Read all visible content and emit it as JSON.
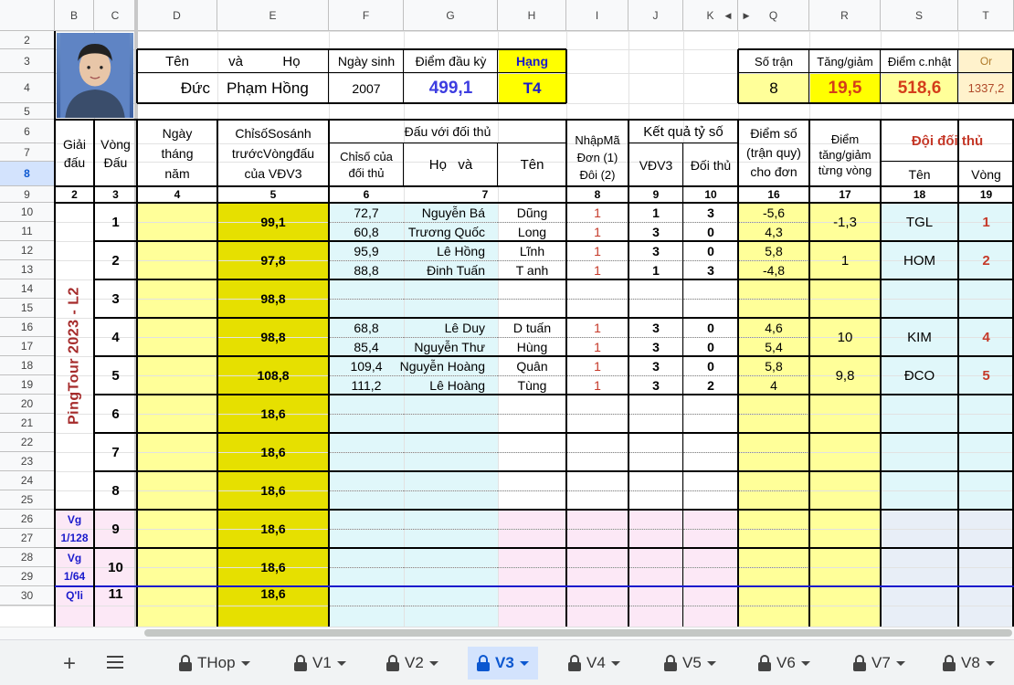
{
  "columns": [
    "B",
    "C",
    "D",
    "E",
    "F",
    "G",
    "H",
    "I",
    "J",
    "K",
    "Q",
    "R",
    "S",
    "T"
  ],
  "rows": [
    "2",
    "3",
    "4",
    "5",
    "6",
    "7",
    "8",
    "9",
    "10",
    "11",
    "12",
    "13",
    "14",
    "15",
    "16",
    "17",
    "18",
    "19",
    "20",
    "21",
    "22",
    "23",
    "24",
    "25",
    "26",
    "27",
    "28",
    "29",
    "30"
  ],
  "selected_row": "8",
  "player": {
    "name_header": {
      "ten": "Tên",
      "va": "và",
      "ho": "Họ"
    },
    "first_name": "Đức",
    "last_name": "Phạm Hồng",
    "dob_label": "Ngày sinh",
    "dob": "2007",
    "start_points_label": "Điểm đầu kỳ",
    "start_points": "499,1",
    "rank_label": "Hạng",
    "rank": "T4"
  },
  "summary": {
    "matches_label": "Số trận",
    "matches": "8",
    "change_label": "Tăng/giảm",
    "change": "19,5",
    "updated_label": "Điểm c.nhật",
    "updated": "518,6",
    "or_label": "Or",
    "or_value": "1337,2"
  },
  "headers": {
    "giai": "Giải đấu",
    "vong_dau": "Vòng Đấu",
    "ngay": "Ngày tháng năm",
    "chiso": "ChỉsốSosánh trướcVòngđấu của VĐV3",
    "dau_voi": "Đấu với đối thủ",
    "chiso_doithu": "Chỉsố của đối thủ",
    "ho_va": "Họ   và",
    "ten": "Tên",
    "nhapma": "NhậpMã Đơn (1) Đôi (2)",
    "ketqua": "Kết quả tỷ số",
    "vdv3": "VĐV3",
    "doithu": "Đối thủ",
    "diemso": "Điểm số (trận quy) cho đơn",
    "diemtang": "Điểm tăng/giảm từng vòng",
    "doi_doithu": "Đội đối thủ",
    "doi_ten": "Tên",
    "doi_vong": "Vòng"
  },
  "index_row": [
    "2",
    "3",
    "4",
    "5",
    "6",
    "7",
    "8",
    "9",
    "10",
    "16",
    "17",
    "18",
    "19"
  ],
  "tournament_label": "PingTour 2023 - L2",
  "rounds": [
    {
      "round": "1",
      "index": "99,1",
      "change": "-1,3",
      "team": "TGL",
      "team_round": "1",
      "matches": [
        {
          "opp_index": "72,7",
          "ho": "Nguyễn Bá",
          "ten": "Dũng",
          "code": "1",
          "my": "1",
          "their": "3",
          "pts": "-5,6"
        },
        {
          "opp_index": "60,8",
          "ho": "Trương Quốc",
          "ten": "Long",
          "code": "1",
          "my": "3",
          "their": "0",
          "pts": "4,3"
        }
      ]
    },
    {
      "round": "2",
      "index": "97,8",
      "change": "1",
      "team": "HOM",
      "team_round": "2",
      "matches": [
        {
          "opp_index": "95,9",
          "ho": "Lê Hồng",
          "ten": "Lĩnh",
          "code": "1",
          "my": "3",
          "their": "0",
          "pts": "5,8"
        },
        {
          "opp_index": "88,8",
          "ho": "Đinh Tuấn",
          "ten": "T anh",
          "code": "1",
          "my": "1",
          "their": "3",
          "pts": "-4,8"
        }
      ]
    },
    {
      "round": "3",
      "index": "98,8",
      "change": "",
      "team": "",
      "team_round": "",
      "matches": []
    },
    {
      "round": "4",
      "index": "98,8",
      "change": "10",
      "team": "KIM",
      "team_round": "4",
      "matches": [
        {
          "opp_index": "68,8",
          "ho": "Lê Duy",
          "ten": "D tuấn",
          "code": "1",
          "my": "3",
          "their": "0",
          "pts": "4,6"
        },
        {
          "opp_index": "85,4",
          "ho": "Nguyễn Thư",
          "ten": "Hùng",
          "code": "1",
          "my": "3",
          "their": "0",
          "pts": "5,4"
        }
      ]
    },
    {
      "round": "5",
      "index": "108,8",
      "change": "9,8",
      "team": "ĐCO",
      "team_round": "5",
      "matches": [
        {
          "opp_index": "109,4",
          "ho": "Nguyễn Hoàng",
          "ten": "Quân",
          "code": "1",
          "my": "3",
          "their": "0",
          "pts": "5,8"
        },
        {
          "opp_index": "111,2",
          "ho": "Lê Hoàng",
          "ten": "Tùng",
          "code": "1",
          "my": "3",
          "their": "2",
          "pts": "4"
        }
      ]
    },
    {
      "round": "6",
      "index": "18,6",
      "change": "",
      "team": "",
      "team_round": "",
      "matches": []
    },
    {
      "round": "7",
      "index": "18,6",
      "change": "",
      "team": "",
      "team_round": "",
      "matches": []
    },
    {
      "round": "8",
      "index": "18,6",
      "change": "",
      "team": "",
      "team_round": "",
      "matches": []
    },
    {
      "round": "9",
      "index": "18,6",
      "stage": "Vg 1/128",
      "change": "",
      "team": "",
      "team_round": "",
      "matches": []
    },
    {
      "round": "10",
      "index": "18,6",
      "stage": "Vg 1/64",
      "change": "",
      "team": "",
      "team_round": "",
      "matches": []
    },
    {
      "round": "11",
      "index": "18,6",
      "stage": "Q'li",
      "change": "",
      "team": "",
      "team_round": "",
      "matches": []
    }
  ],
  "sheet_tabs": {
    "add_icon": "plus-icon",
    "menu_icon": "hamburger-icon",
    "tabs": [
      {
        "label": "THop",
        "active": false
      },
      {
        "label": "V1",
        "active": false
      },
      {
        "label": "V2",
        "active": false
      },
      {
        "label": "V3",
        "active": true
      },
      {
        "label": "V4",
        "active": false
      },
      {
        "label": "V5",
        "active": false
      },
      {
        "label": "V6",
        "active": false
      },
      {
        "label": "V7",
        "active": false
      },
      {
        "label": "V8",
        "active": false
      }
    ]
  },
  "colors": {
    "yellow": "#ffff00",
    "light_yellow": "#ffff99",
    "olive": "#e6e000",
    "light_blue": "#e0f7fa",
    "cream": "#fff2cc",
    "pink": "#fce8f6",
    "highlight_blue": "#d3e3fd"
  }
}
